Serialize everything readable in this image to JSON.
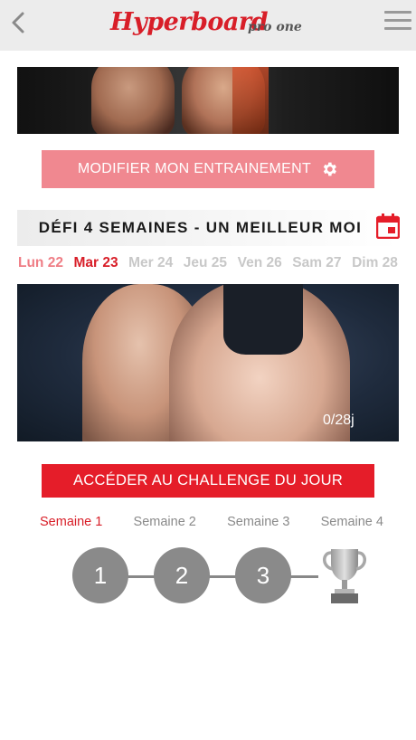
{
  "header": {
    "brand": "Hyperboard",
    "subtitle": "pro one",
    "brand_color": "#d81e28",
    "back_icon": "chevron-left-icon",
    "menu_icon": "hamburger-menu-icon"
  },
  "modify_button": {
    "label": "MODIFIER MON ENTRAINEMENT",
    "icon": "gear-icon",
    "color": "#f08890"
  },
  "challenge": {
    "title": "DÉFI 4 SEMAINES - UN MEILLEUR MOI",
    "calendar_icon": "calendar-icon"
  },
  "days": [
    {
      "label": "Lun 22",
      "state": "past"
    },
    {
      "label": "Mar 23",
      "state": "today"
    },
    {
      "label": "Mer 24",
      "state": "future"
    },
    {
      "label": "Jeu 25",
      "state": "future"
    },
    {
      "label": "Ven 26",
      "state": "future"
    },
    {
      "label": "Sam 27",
      "state": "future"
    },
    {
      "label": "Dim 28",
      "state": "future"
    }
  ],
  "hero": {
    "progress": "0/28j"
  },
  "access_button": {
    "label": "ACCÉDER AU CHALLENGE DU JOUR",
    "color": "#e51d29"
  },
  "weeks": [
    {
      "label": "Semaine 1",
      "active": true
    },
    {
      "label": "Semaine 2",
      "active": false
    },
    {
      "label": "Semaine 3",
      "active": false
    },
    {
      "label": "Semaine 4",
      "active": false
    }
  ],
  "steps": [
    "1",
    "2",
    "3"
  ],
  "final_step_icon": "trophy-icon"
}
